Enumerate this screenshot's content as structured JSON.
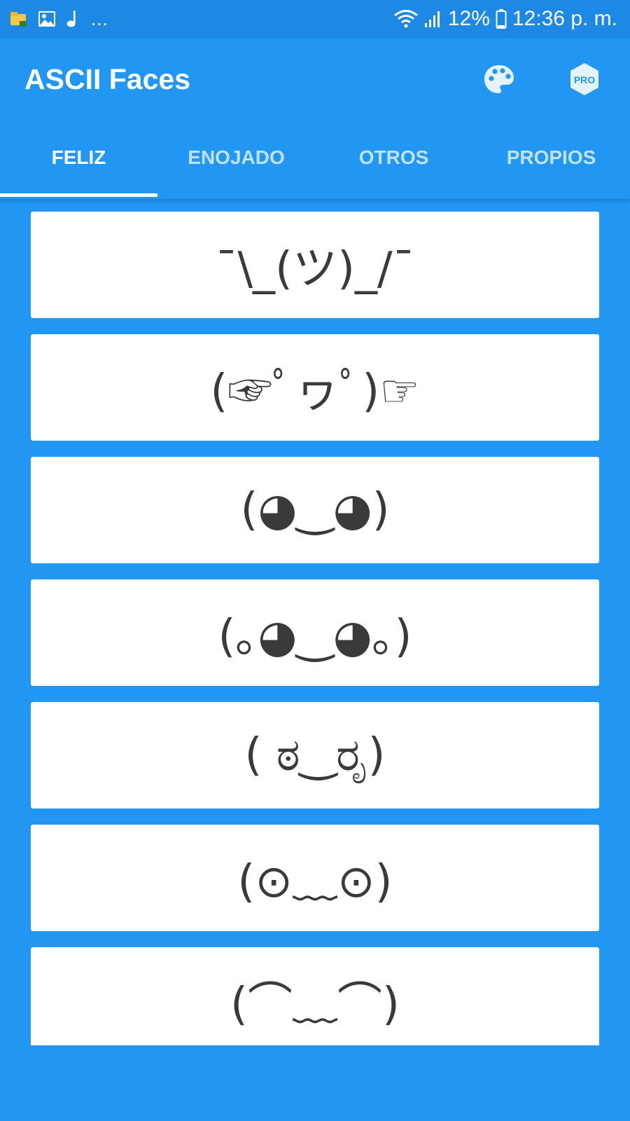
{
  "status_bar": {
    "notification_icons": [
      "folder-icon",
      "image-icon",
      "music-note-icon"
    ],
    "more_dots": "...",
    "battery": "12%",
    "time": "12:36 p. m."
  },
  "app_bar": {
    "title": "ASCII Faces",
    "pro_badge": "PRO",
    "colors": {
      "primary": "#2196F3",
      "status_bar": "#1E88E5",
      "card": "#FFFFFF"
    }
  },
  "tabs": [
    {
      "label": "FELIZ",
      "active": true
    },
    {
      "label": "ENOJADO",
      "active": false
    },
    {
      "label": "OTROS",
      "active": false
    },
    {
      "label": "PROPIOS",
      "active": false
    }
  ],
  "faces": [
    "¯\\_(ツ)_/¯",
    "(☞ﾟヮﾟ)☞",
    "(◕‿◕)",
    "(｡◕‿◕｡)",
    "( ಠ‿ರೃ)",
    "(⊙﹏⊙)",
    "(⌒﹏⌒)"
  ]
}
